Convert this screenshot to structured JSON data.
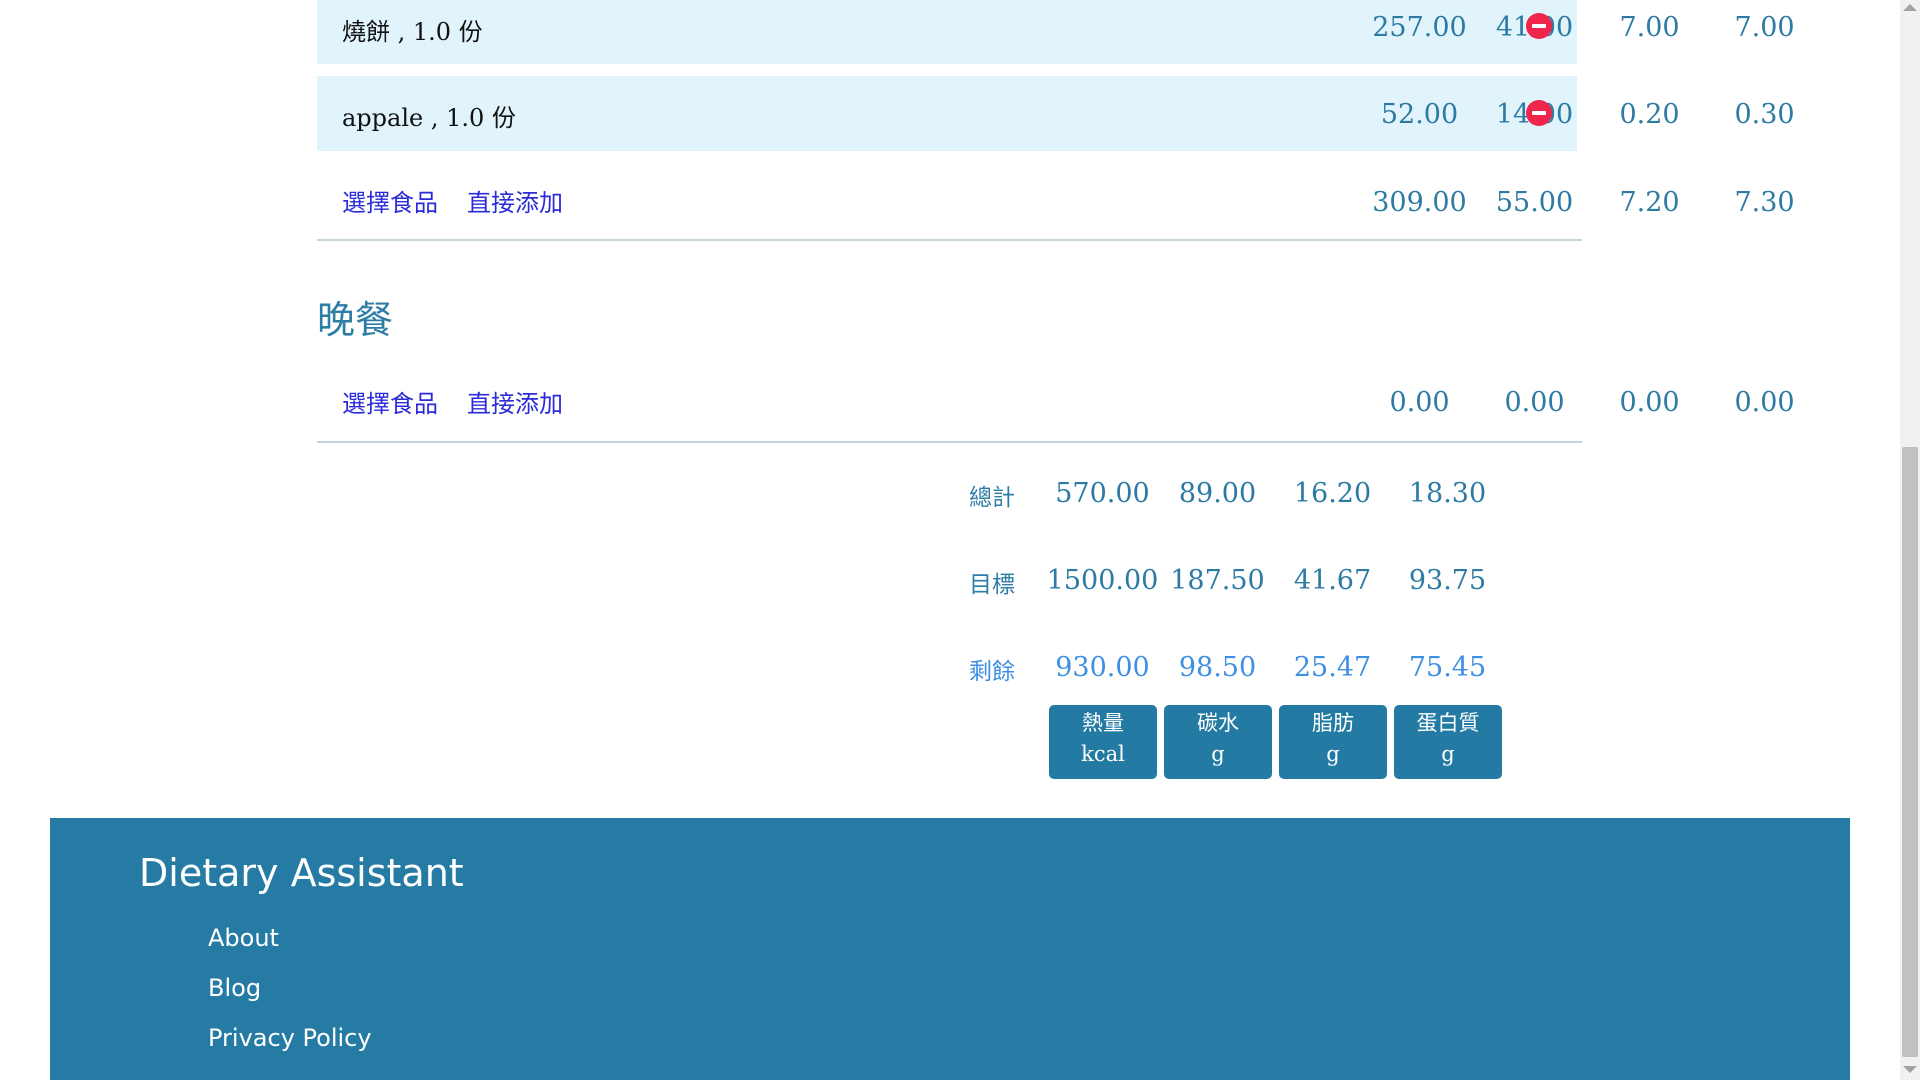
{
  "lunch": {
    "items": [
      {
        "name": "燒餅 , 1.0 份",
        "kcal": "257.00",
        "carb": "41.00",
        "fat": "7.00",
        "protein": "7.00"
      },
      {
        "name": "appale , 1.0 份",
        "kcal": "52.00",
        "carb": "14.00",
        "fat": "0.20",
        "protein": "0.30"
      }
    ],
    "select_food_label": "選擇食品",
    "add_direct_label": "直接添加",
    "subtotal": {
      "kcal": "309.00",
      "carb": "55.00",
      "fat": "7.20",
      "protein": "7.30"
    }
  },
  "dinner": {
    "title": "晚餐",
    "select_food_label": "選擇食品",
    "add_direct_label": "直接添加",
    "subtotal": {
      "kcal": "0.00",
      "carb": "0.00",
      "fat": "0.00",
      "protein": "0.00"
    }
  },
  "totals": {
    "total_label": "總計",
    "total": {
      "kcal": "570.00",
      "carb": "89.00",
      "fat": "16.20",
      "protein": "18.30"
    },
    "target_label": "目標",
    "target": {
      "kcal": "1500.00",
      "carb": "187.50",
      "fat": "41.67",
      "protein": "93.75"
    },
    "remaining_label": "剩餘",
    "remaining": {
      "kcal": "930.00",
      "carb": "98.50",
      "fat": "25.47",
      "protein": "75.45"
    }
  },
  "units": [
    {
      "name": "熱量",
      "unit": "kcal"
    },
    {
      "name": "碳水",
      "unit": "g"
    },
    {
      "name": "脂肪",
      "unit": "g"
    },
    {
      "name": "蛋白質",
      "unit": "g"
    }
  ],
  "footer": {
    "title": "Dietary Assistant",
    "links": [
      "About",
      "Blog",
      "Privacy Policy"
    ]
  },
  "colors": {
    "accent": "#257ba4",
    "row_background": "#e1f4fc",
    "remove_red": "#f0254c",
    "link_blue": "#2b2bd9",
    "remaining_blue": "#3f8fe3"
  },
  "icons": {
    "remove": "minus-circle-icon"
  }
}
